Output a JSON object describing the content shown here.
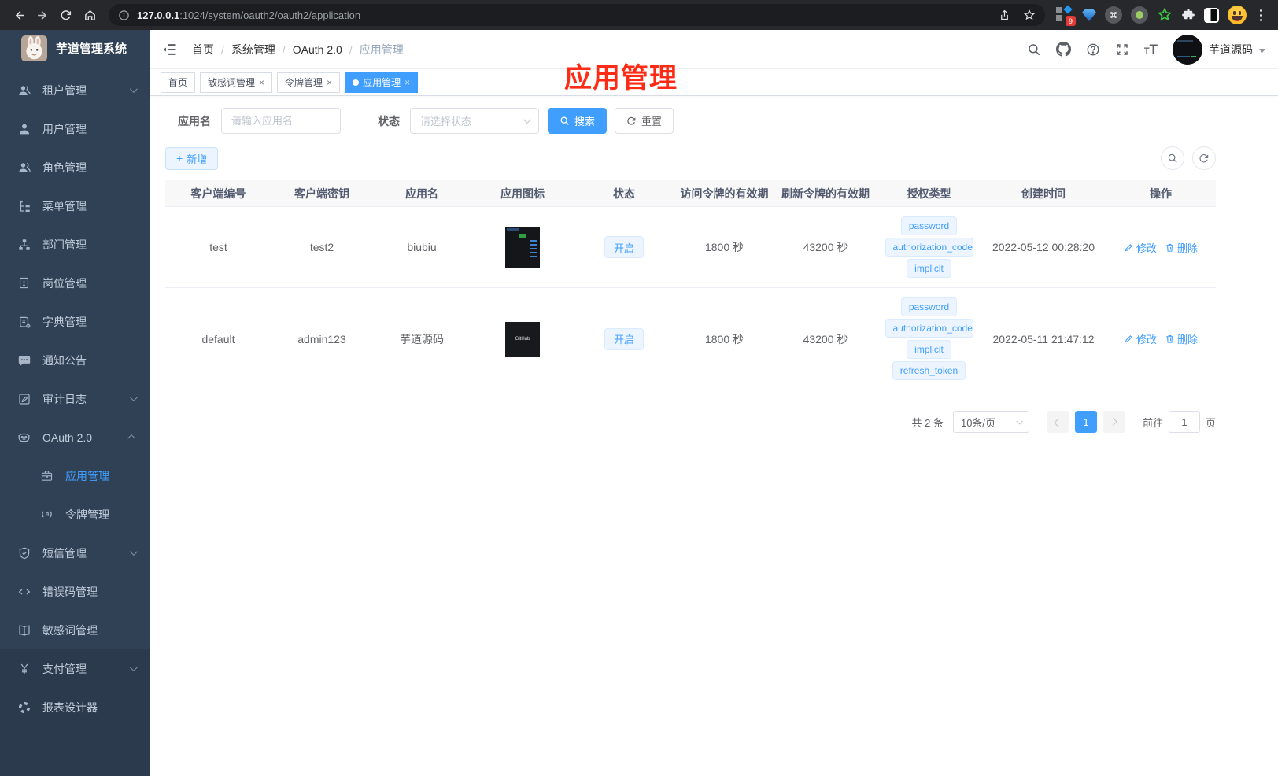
{
  "browser": {
    "url_host": "127.0.0.1",
    "url_path": ":1024/system/oauth2/oauth2/application",
    "ext_badge": "9"
  },
  "sidebar": {
    "title": "芋道管理系统",
    "menu": [
      {
        "label": "租户管理",
        "icon": "tenant-users-icon",
        "arrow": "down"
      },
      {
        "label": "用户管理",
        "icon": "user-icon"
      },
      {
        "label": "角色管理",
        "icon": "role-users-icon"
      },
      {
        "label": "菜单管理",
        "icon": "menu-tree-icon"
      },
      {
        "label": "部门管理",
        "icon": "org-chart-icon"
      },
      {
        "label": "岗位管理",
        "icon": "post-badge-icon"
      },
      {
        "label": "字典管理",
        "icon": "dict-book-icon"
      },
      {
        "label": "通知公告",
        "icon": "notice-comment-icon"
      },
      {
        "label": "审计日志",
        "icon": "audit-log-icon",
        "arrow": "down"
      },
      {
        "label": "OAuth 2.0",
        "icon": "oauth-robot-icon",
        "arrow": "up",
        "children": [
          {
            "label": "应用管理",
            "icon": "app-briefcase-icon",
            "active": true
          },
          {
            "label": "令牌管理",
            "icon": "token-signal-icon"
          }
        ]
      },
      {
        "label": "短信管理",
        "icon": "sms-shield-icon",
        "arrow": "down"
      },
      {
        "label": "错误码管理",
        "icon": "errcode-icon"
      },
      {
        "label": "敏感词管理",
        "icon": "sensitive-book-icon"
      },
      {
        "label": "支付管理",
        "icon": "pay-yen-icon",
        "arrow": "down",
        "section": 2
      },
      {
        "label": "报表设计器",
        "icon": "report-designer-icon",
        "section": 2
      }
    ]
  },
  "header": {
    "breadcrumb": [
      "首页",
      "系统管理",
      "OAuth 2.0",
      "应用管理"
    ],
    "username": "芋道源码"
  },
  "tabs": [
    {
      "label": "首页",
      "closable": false,
      "active": false
    },
    {
      "label": "敏感词管理",
      "closable": true,
      "active": false
    },
    {
      "label": "令牌管理",
      "closable": true,
      "active": false
    },
    {
      "label": "应用管理",
      "closable": true,
      "active": true
    }
  ],
  "annotation": {
    "text": "应用管理"
  },
  "filters": {
    "name_label": "应用名",
    "name_placeholder": "请输入应用名",
    "status_label": "状态",
    "status_placeholder": "请选择状态",
    "search_label": "搜索",
    "reset_label": "重置",
    "add_label": "新增"
  },
  "table": {
    "columns": [
      "客户端编号",
      "客户端密钥",
      "应用名",
      "应用图标",
      "状态",
      "访问令牌的有效期",
      "刷新令牌的有效期",
      "授权类型",
      "创建时间",
      "操作"
    ],
    "edit_label": "修改",
    "delete_label": "删除",
    "rows": [
      {
        "client_id": "test",
        "client_secret": "test2",
        "app_name": "biubiu",
        "icon_thumb": "app-screenshot-thumb",
        "icon_label": "",
        "status": "开启",
        "access_token_validity": "1800 秒",
        "refresh_token_validity": "43200 秒",
        "grant_types": [
          "password",
          "authorization_code",
          "implicit"
        ],
        "create_time": "2022-05-12 00:28:20"
      },
      {
        "client_id": "default",
        "client_secret": "admin123",
        "app_name": "芋道源码",
        "icon_thumb": "github-thumb",
        "icon_label": "GitHub",
        "status": "开启",
        "access_token_validity": "1800 秒",
        "refresh_token_validity": "43200 秒",
        "grant_types": [
          "password",
          "authorization_code",
          "implicit",
          "refresh_token"
        ],
        "create_time": "2022-05-11 21:47:12"
      }
    ]
  },
  "pagination": {
    "total_text": "共 2 条",
    "page_size": "10条/页",
    "current_page": "1",
    "goto_label": "前往",
    "goto_value": "1",
    "page_unit": "页"
  },
  "colors": {
    "accent": "#409eff",
    "annotation_red": "#fe2c17",
    "sidebar_bg": "#304156"
  }
}
